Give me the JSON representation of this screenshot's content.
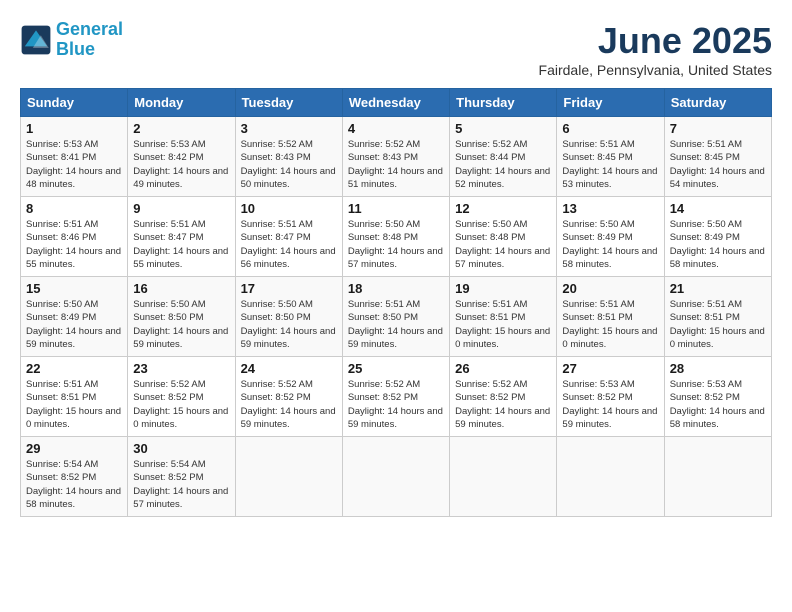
{
  "logo": {
    "line1": "General",
    "line2": "Blue"
  },
  "title": "June 2025",
  "subtitle": "Fairdale, Pennsylvania, United States",
  "weekdays": [
    "Sunday",
    "Monday",
    "Tuesday",
    "Wednesday",
    "Thursday",
    "Friday",
    "Saturday"
  ],
  "weeks": [
    [
      {
        "day": "1",
        "sunrise": "5:53 AM",
        "sunset": "8:41 PM",
        "daylight": "14 hours and 48 minutes."
      },
      {
        "day": "2",
        "sunrise": "5:53 AM",
        "sunset": "8:42 PM",
        "daylight": "14 hours and 49 minutes."
      },
      {
        "day": "3",
        "sunrise": "5:52 AM",
        "sunset": "8:43 PM",
        "daylight": "14 hours and 50 minutes."
      },
      {
        "day": "4",
        "sunrise": "5:52 AM",
        "sunset": "8:43 PM",
        "daylight": "14 hours and 51 minutes."
      },
      {
        "day": "5",
        "sunrise": "5:52 AM",
        "sunset": "8:44 PM",
        "daylight": "14 hours and 52 minutes."
      },
      {
        "day": "6",
        "sunrise": "5:51 AM",
        "sunset": "8:45 PM",
        "daylight": "14 hours and 53 minutes."
      },
      {
        "day": "7",
        "sunrise": "5:51 AM",
        "sunset": "8:45 PM",
        "daylight": "14 hours and 54 minutes."
      }
    ],
    [
      {
        "day": "8",
        "sunrise": "5:51 AM",
        "sunset": "8:46 PM",
        "daylight": "14 hours and 55 minutes."
      },
      {
        "day": "9",
        "sunrise": "5:51 AM",
        "sunset": "8:47 PM",
        "daylight": "14 hours and 55 minutes."
      },
      {
        "day": "10",
        "sunrise": "5:51 AM",
        "sunset": "8:47 PM",
        "daylight": "14 hours and 56 minutes."
      },
      {
        "day": "11",
        "sunrise": "5:50 AM",
        "sunset": "8:48 PM",
        "daylight": "14 hours and 57 minutes."
      },
      {
        "day": "12",
        "sunrise": "5:50 AM",
        "sunset": "8:48 PM",
        "daylight": "14 hours and 57 minutes."
      },
      {
        "day": "13",
        "sunrise": "5:50 AM",
        "sunset": "8:49 PM",
        "daylight": "14 hours and 58 minutes."
      },
      {
        "day": "14",
        "sunrise": "5:50 AM",
        "sunset": "8:49 PM",
        "daylight": "14 hours and 58 minutes."
      }
    ],
    [
      {
        "day": "15",
        "sunrise": "5:50 AM",
        "sunset": "8:49 PM",
        "daylight": "14 hours and 59 minutes."
      },
      {
        "day": "16",
        "sunrise": "5:50 AM",
        "sunset": "8:50 PM",
        "daylight": "14 hours and 59 minutes."
      },
      {
        "day": "17",
        "sunrise": "5:50 AM",
        "sunset": "8:50 PM",
        "daylight": "14 hours and 59 minutes."
      },
      {
        "day": "18",
        "sunrise": "5:51 AM",
        "sunset": "8:50 PM",
        "daylight": "14 hours and 59 minutes."
      },
      {
        "day": "19",
        "sunrise": "5:51 AM",
        "sunset": "8:51 PM",
        "daylight": "15 hours and 0 minutes."
      },
      {
        "day": "20",
        "sunrise": "5:51 AM",
        "sunset": "8:51 PM",
        "daylight": "15 hours and 0 minutes."
      },
      {
        "day": "21",
        "sunrise": "5:51 AM",
        "sunset": "8:51 PM",
        "daylight": "15 hours and 0 minutes."
      }
    ],
    [
      {
        "day": "22",
        "sunrise": "5:51 AM",
        "sunset": "8:51 PM",
        "daylight": "15 hours and 0 minutes."
      },
      {
        "day": "23",
        "sunrise": "5:52 AM",
        "sunset": "8:52 PM",
        "daylight": "15 hours and 0 minutes."
      },
      {
        "day": "24",
        "sunrise": "5:52 AM",
        "sunset": "8:52 PM",
        "daylight": "14 hours and 59 minutes."
      },
      {
        "day": "25",
        "sunrise": "5:52 AM",
        "sunset": "8:52 PM",
        "daylight": "14 hours and 59 minutes."
      },
      {
        "day": "26",
        "sunrise": "5:52 AM",
        "sunset": "8:52 PM",
        "daylight": "14 hours and 59 minutes."
      },
      {
        "day": "27",
        "sunrise": "5:53 AM",
        "sunset": "8:52 PM",
        "daylight": "14 hours and 59 minutes."
      },
      {
        "day": "28",
        "sunrise": "5:53 AM",
        "sunset": "8:52 PM",
        "daylight": "14 hours and 58 minutes."
      }
    ],
    [
      {
        "day": "29",
        "sunrise": "5:54 AM",
        "sunset": "8:52 PM",
        "daylight": "14 hours and 58 minutes."
      },
      {
        "day": "30",
        "sunrise": "5:54 AM",
        "sunset": "8:52 PM",
        "daylight": "14 hours and 57 minutes."
      },
      null,
      null,
      null,
      null,
      null
    ]
  ]
}
